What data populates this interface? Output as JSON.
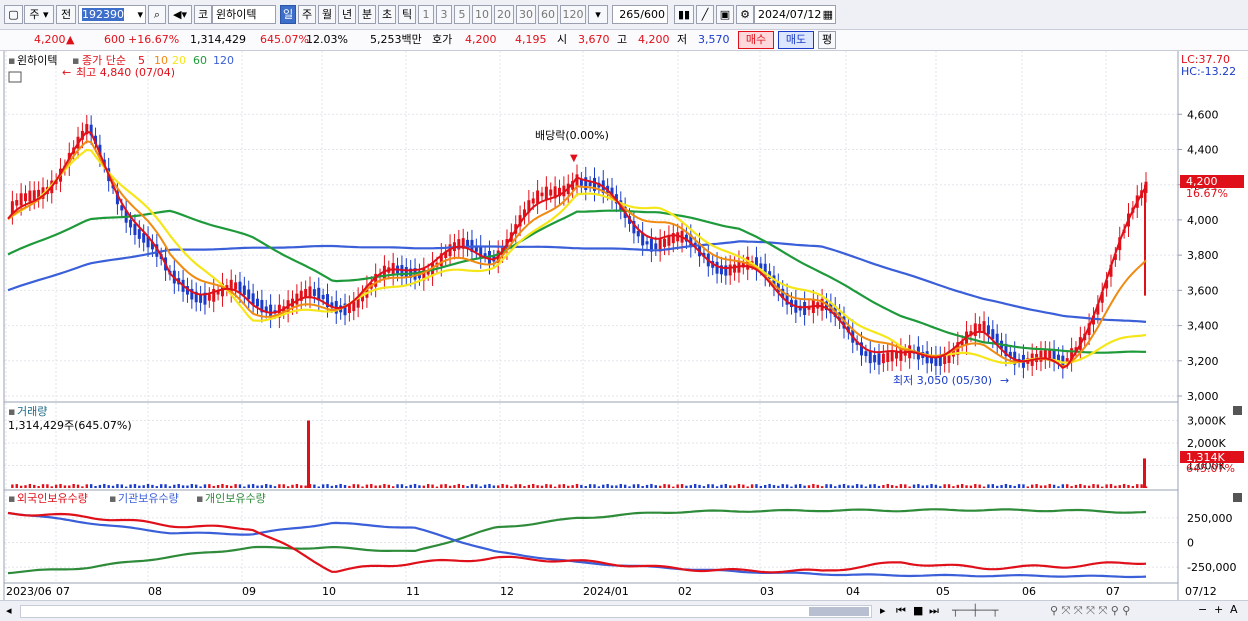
{
  "toolbar": {
    "tab_ju": "주",
    "tab_jeon": "전",
    "code": "192390",
    "market": "코",
    "name": "윈하이텍",
    "periods": [
      "일",
      "주",
      "월",
      "년",
      "분",
      "초",
      "틱"
    ],
    "selected_period": "일",
    "intervals": [
      "1",
      "3",
      "5",
      "10",
      "20",
      "30",
      "60",
      "120"
    ],
    "count": "265",
    "count_total": "/600",
    "date": "2024/07/12"
  },
  "quote": {
    "price": "4,200",
    "arrow": "▲",
    "change": "600",
    "change_pct": "+16.67%",
    "volume": "1,314,429",
    "volume_ratio": "645.07%",
    "turnover": "12.03%",
    "amount": "5,253백만",
    "hoga_label": "호가",
    "hoga_value": "4,200",
    "hoga_value2": "4,195",
    "open_label": "시",
    "open": "3,670",
    "high_label": "고",
    "high": "4,200",
    "low_label": "저",
    "low": "3,570",
    "buy_label": "매수",
    "sell_label": "매도",
    "eval_label": "평"
  },
  "price_panel": {
    "stock_name": "윈하이텍",
    "ma_label": "종가 단순",
    "ma_periods": [
      "5",
      "10",
      "20",
      "60",
      "120"
    ],
    "max_note": "최고 4,840 (07/04)",
    "min_note": "최저 3,050 (05/30)",
    "dividend_note": "배당락(0.00%)",
    "lc": "LC:37.70",
    "hc": "HC:-13.22",
    "last_price_tag": "4,200",
    "last_pct_tag": "16.67%",
    "y_ticks": [
      "4,600",
      "4,400",
      "4,200",
      "4,000",
      "3,800",
      "3,600",
      "3,400",
      "3,200",
      "3,000"
    ]
  },
  "volume_panel": {
    "title": "거래량",
    "value": "1,314,429주(645.07%)",
    "y_ticks": [
      "3,000K",
      "2,000K",
      "1,000K"
    ],
    "last_tag": "1,314K",
    "last_pct": "645.07%"
  },
  "holdings_panel": {
    "legend": [
      "외국인보유수량",
      "기관보유수량",
      "개인보유수량"
    ],
    "y_ticks": [
      "250,000",
      "0",
      "-250,000"
    ]
  },
  "x_axis": {
    "labels": [
      "2023/06",
      "07",
      "08",
      "09",
      "10",
      "11",
      "12",
      "2024/01",
      "02",
      "03",
      "04",
      "05",
      "06",
      "07"
    ],
    "right_label": "07/12"
  },
  "colors": {
    "up": "#e0101a",
    "down": "#1a3cc8",
    "ma5": "#e0101a",
    "ma10": "#f08a10",
    "ma20": "#f5e61a",
    "ma60": "#1e9a3a",
    "ma120": "#3a5fd8",
    "foreign": "#e0101a",
    "institution": "#3a5fd8",
    "individual": "#2e8b3a"
  },
  "chart_data": {
    "type": "line",
    "title": "윈하이텍 (192390) 일봉",
    "x": [
      "2023/06",
      "07",
      "08",
      "09",
      "10",
      "11",
      "12",
      "2024/01",
      "02",
      "03",
      "04",
      "05",
      "06",
      "07"
    ],
    "series": [
      {
        "name": "종가",
        "values": [
          3950,
          4500,
          3650,
          3500,
          3550,
          3750,
          3800,
          4300,
          3900,
          3700,
          3500,
          3200,
          3300,
          3150,
          4200
        ]
      },
      {
        "name": "20",
        "values": [
          4000,
          4400,
          3900,
          3450,
          3500,
          3650,
          3750,
          4150,
          4050,
          3780,
          3560,
          3250,
          3220,
          3200,
          3350
        ]
      },
      {
        "name": "60",
        "values": [
          3800,
          4000,
          4050,
          3900,
          3650,
          3700,
          3800,
          4050,
          4050,
          3950,
          3700,
          3450,
          3300,
          3250,
          3250
        ]
      },
      {
        "name": "120",
        "values": [
          3600,
          3750,
          3830,
          3840,
          3850,
          3840,
          3850,
          3840,
          3830,
          3880,
          3850,
          3700,
          3550,
          3450,
          3420
        ]
      }
    ],
    "ylim": [
      3000,
      4840
    ],
    "volume": {
      "name": "거래량",
      "last": 1314429,
      "max_spike": 3000000
    },
    "holdings": [
      {
        "name": "외국인보유수량",
        "values": [
          300000,
          250000,
          180000,
          150000,
          -300000,
          -200000,
          -150000,
          -200000,
          -250000,
          -280000,
          -300000,
          -200000,
          -250000,
          -250000,
          -200000
        ]
      },
      {
        "name": "기관보유수량",
        "values": [
          300000,
          200000,
          100000,
          80000,
          200000,
          150000,
          -100000,
          -200000,
          -250000,
          -300000,
          -320000,
          -330000,
          -340000,
          -340000,
          -340000
        ]
      },
      {
        "name": "개인보유수량",
        "values": [
          -300000,
          -250000,
          -150000,
          -50000,
          -50000,
          -100000,
          150000,
          250000,
          300000,
          320000,
          330000,
          320000,
          330000,
          330000,
          300000
        ]
      }
    ]
  }
}
